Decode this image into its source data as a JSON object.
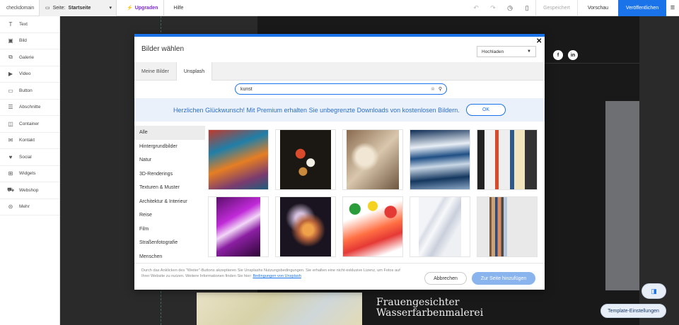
{
  "topbar": {
    "logo": "checkdomain",
    "page_label": "Seite:",
    "page_value": "Startseite",
    "upgrade": "Upgraden",
    "help": "Hilfe",
    "saved": "Gespeichert",
    "preview": "Vorschau",
    "publish": "Veröffentlichen"
  },
  "sidebar": {
    "items": [
      {
        "label": "Text",
        "icon": "text-icon"
      },
      {
        "label": "Bild",
        "icon": "image-icon"
      },
      {
        "label": "Galerie",
        "icon": "gallery-icon"
      },
      {
        "label": "Video",
        "icon": "video-icon"
      },
      {
        "label": "Button",
        "icon": "button-icon"
      },
      {
        "label": "Abschnitte",
        "icon": "sections-icon"
      },
      {
        "label": "Container",
        "icon": "container-icon"
      },
      {
        "label": "Kontakt",
        "icon": "contact-icon"
      },
      {
        "label": "Social",
        "icon": "social-icon"
      },
      {
        "label": "Widgets",
        "icon": "widgets-icon"
      },
      {
        "label": "Webshop",
        "icon": "cart-icon"
      },
      {
        "label": "Mehr",
        "icon": "more-icon"
      }
    ]
  },
  "site": {
    "title_line1": "Frauengesichter",
    "title_line2": "Wasserfarbenmalerei",
    "social_facebook": "f",
    "social_linkedin": "in"
  },
  "modal": {
    "title": "Bilder wählen",
    "upload_select": "Hochladen",
    "tabs": [
      "Meine Bilder",
      "Unsplash"
    ],
    "search_value": "kunst",
    "promo_text": "Herzlichen Glückwunsch! Mit Premium erhalten Sie unbegrenzte Downloads von kostenlosen Bildern.",
    "promo_ok": "OK",
    "categories": [
      "Alle",
      "Hintergrundbilder",
      "Natur",
      "3D-Renderings",
      "Texturen & Muster",
      "Architektur & Interieur",
      "Reise",
      "Film",
      "Straßenfotografie",
      "Menschen"
    ],
    "footer_text": "Durch das Anklicken des \"Weiter\"-Buttons akzeptieren Sie Unsplashs Nutzungsbedingungen. Sie erhalten eine nicht-exklusive Lizenz, um Fotos auf Ihrer Website zu nutzen. Weitere Informationen finden Sie hier:",
    "footer_link": "Bedingungen von Unsplash",
    "cancel": "Abbrechen",
    "add": "Zur Seite hinzufügen"
  },
  "template_settings": "Template-Einstellungen",
  "colors": {
    "accent": "#1a73e8",
    "upgrade": "#7a2bd3"
  }
}
